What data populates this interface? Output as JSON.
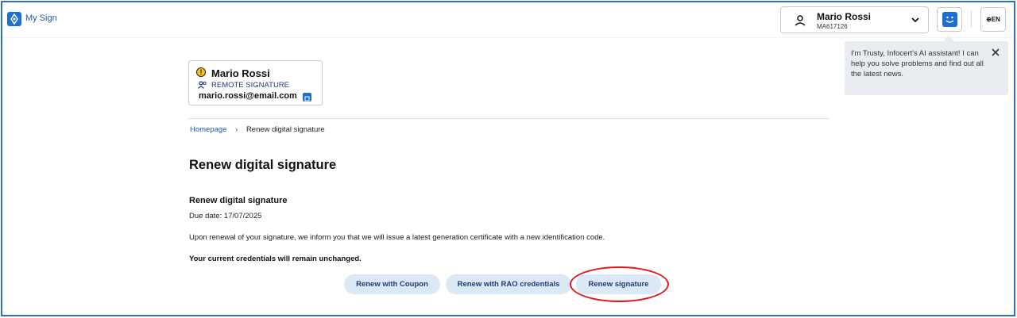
{
  "header": {
    "logo_icon": "sign-logo-icon",
    "app_title": "My Sign",
    "user": {
      "name": "Mario Rossi",
      "code": "MA617126",
      "icon": "person-icon",
      "dropdown_icon": "chevron-down-icon"
    },
    "assistant_icon": "ai-assistant-icon",
    "language": "⊕EN"
  },
  "tooltip": {
    "text": "I'm Trusty, Infocert's AI assistant! I can help you solve problems and find out all the latest news.",
    "close_icon": "close-icon"
  },
  "profile": {
    "name": "Mario Rossi",
    "type": "REMOTE SIGNATURE",
    "email": "mario.rossi@email.com",
    "warning_icon": "warning-icon",
    "edit_icon": "edit-icon"
  },
  "breadcrumb": {
    "home": "Homepage",
    "separator": "›",
    "current": "Renew digital signature"
  },
  "main": {
    "title": "Renew digital signature",
    "section_title": "Renew digital signature",
    "due_date": "Due date: 17/07/2025",
    "notice": "Upon renewal of your signature, we inform you that we will issue a latest generation certificate with a new identification code.",
    "notice_bold": "Your current credentials will remain unchanged."
  },
  "buttons": {
    "coupon": "Renew with Coupon",
    "rao": "Renew with RAO credentials",
    "renew": "Renew signature"
  },
  "colors": {
    "brand_blue": "#1a6fd0",
    "button_bg": "#dbe8f5",
    "highlight_red": "#e3151f",
    "frame_border": "#2f6fb3"
  }
}
